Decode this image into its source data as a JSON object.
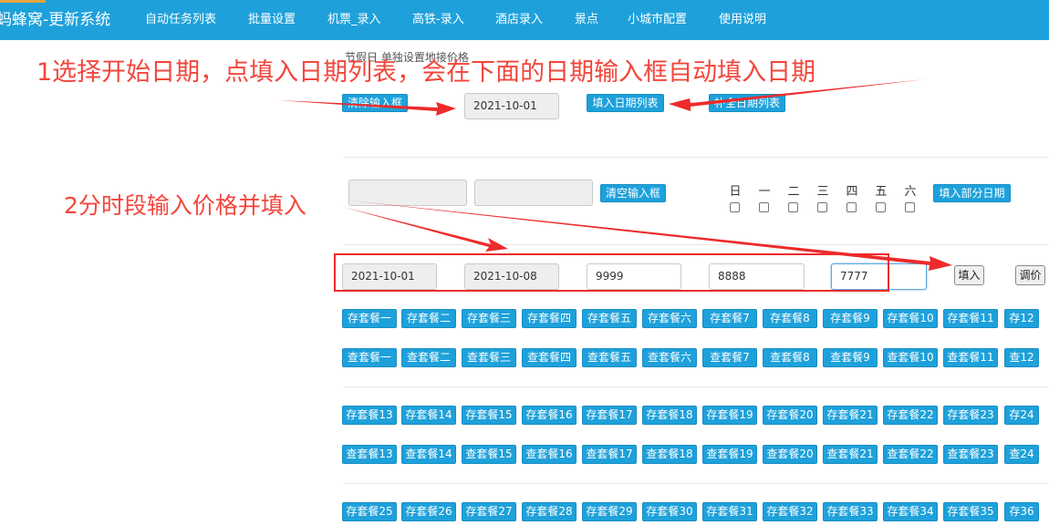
{
  "nav": {
    "brand": "蚂蜂窝-更新系统",
    "items": [
      "自动任务列表",
      "批量设置",
      "机票_录入",
      "高铁-录入",
      "酒店录入",
      "景点",
      "小城市配置",
      "使用说明"
    ]
  },
  "section_title": "节假日 单独设置地接价格",
  "top_row": {
    "clear_button": "清除输入框",
    "start_date_value": "2021-10-01",
    "fill_date_list_button": "填入日期列表",
    "complete_date_list_button": "补全日期列表"
  },
  "second_row": {
    "input_a_value": "",
    "input_b_value": "",
    "clear_inputs_button": "清空输入框",
    "weekdays": [
      "日",
      "一",
      "二",
      "三",
      "四",
      "五",
      "六"
    ],
    "fill_partial_dates_button": "填入部分日期"
  },
  "price_row": {
    "date_from": "2021-10-01",
    "date_to": "2021-10-08",
    "price_1": "9999",
    "price_2": "8888",
    "price_3": "7777",
    "fill_button": "填入",
    "adjust_button": "调价"
  },
  "packages": {
    "row1_save": [
      "存套餐一",
      "存套餐二",
      "存套餐三",
      "存套餐四",
      "存套餐五",
      "存套餐六",
      "存套餐7",
      "存套餐8",
      "存套餐9",
      "存套餐10",
      "存套餐11",
      "存12"
    ],
    "row1_query": [
      "查套餐一",
      "查套餐二",
      "查套餐三",
      "查套餐四",
      "查套餐五",
      "查套餐六",
      "查套餐7",
      "查套餐8",
      "查套餐9",
      "查套餐10",
      "查套餐11",
      "查12"
    ],
    "row2_save": [
      "存套餐13",
      "存套餐14",
      "存套餐15",
      "存套餐16",
      "存套餐17",
      "存套餐18",
      "存套餐19",
      "存套餐20",
      "存套餐21",
      "存套餐22",
      "存套餐23",
      "存24"
    ],
    "row2_query": [
      "查套餐13",
      "查套餐14",
      "查套餐15",
      "查套餐16",
      "查套餐17",
      "查套餐18",
      "查套餐19",
      "查套餐20",
      "查套餐21",
      "查套餐22",
      "查套餐23",
      "查24"
    ],
    "row3_save": [
      "存套餐25",
      "存套餐26",
      "存套餐27",
      "存套餐28",
      "存套餐29",
      "存套餐30",
      "存套餐31",
      "存套餐32",
      "存套餐33",
      "存套餐34",
      "存套餐35",
      "存36"
    ]
  },
  "annotations": {
    "step1": "1选择开始日期，点填入日期列表，会在下面的日期输入框自动填入日期",
    "step2": "2分时段输入价格并填入"
  },
  "colors": {
    "nav_bg": "#1ea1db",
    "button_bg": "#1ea1db",
    "annotation_red": "#f2463c"
  }
}
